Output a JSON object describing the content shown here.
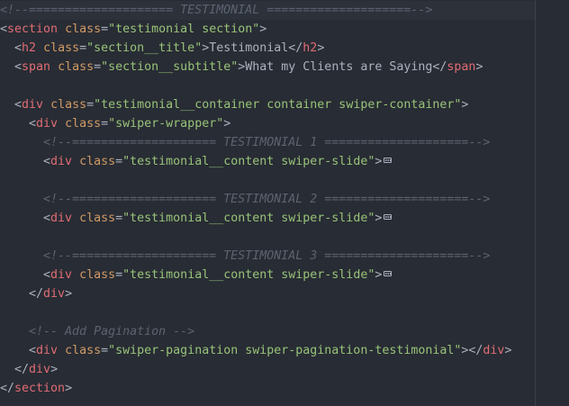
{
  "editor": {
    "language": "html",
    "colors": {
      "background": "#282c34",
      "comment": "#5c6370",
      "tag": "#e06c75",
      "attribute": "#d19a66",
      "string": "#98c379",
      "text": "#abb2bf"
    },
    "lines": [
      [
        [
          "c",
          "<!--==================== TESTIMONIAL ====================-->"
        ]
      ],
      [
        [
          "p",
          "<"
        ],
        [
          "t",
          "section"
        ],
        [
          "p",
          " "
        ],
        [
          "a",
          "class"
        ],
        [
          "p",
          "="
        ],
        [
          "s",
          "\"testimonial section\""
        ],
        [
          "p",
          ">"
        ]
      ],
      [
        [
          "p",
          "  <"
        ],
        [
          "t",
          "h2"
        ],
        [
          "p",
          " "
        ],
        [
          "a",
          "class"
        ],
        [
          "p",
          "="
        ],
        [
          "s",
          "\"section__title\""
        ],
        [
          "p",
          ">"
        ],
        [
          "tx",
          "Testimonial"
        ],
        [
          "p",
          "</"
        ],
        [
          "t",
          "h2"
        ],
        [
          "p",
          ">"
        ]
      ],
      [
        [
          "p",
          "  <"
        ],
        [
          "t",
          "span"
        ],
        [
          "p",
          " "
        ],
        [
          "a",
          "class"
        ],
        [
          "p",
          "="
        ],
        [
          "s",
          "\"section__subtitle\""
        ],
        [
          "p",
          ">"
        ],
        [
          "tx",
          "What my Clients are Saying"
        ],
        [
          "p",
          "</"
        ],
        [
          "t",
          "span"
        ],
        [
          "p",
          ">"
        ]
      ],
      [],
      [
        [
          "p",
          "  <"
        ],
        [
          "t",
          "div"
        ],
        [
          "p",
          " "
        ],
        [
          "a",
          "class"
        ],
        [
          "p",
          "="
        ],
        [
          "s",
          "\"testimonial__container container swiper-container\""
        ],
        [
          "p",
          ">"
        ]
      ],
      [
        [
          "p",
          "    <"
        ],
        [
          "t",
          "div"
        ],
        [
          "p",
          " "
        ],
        [
          "a",
          "class"
        ],
        [
          "p",
          "="
        ],
        [
          "s",
          "\"swiper-wrapper\""
        ],
        [
          "p",
          ">"
        ]
      ],
      [
        [
          "c",
          "      <!--==================== TESTIMONIAL 1 ====================-->"
        ]
      ],
      [
        [
          "p",
          "      <"
        ],
        [
          "t",
          "div"
        ],
        [
          "p",
          " "
        ],
        [
          "a",
          "class"
        ],
        [
          "p",
          "="
        ],
        [
          "s",
          "\"testimonial__content swiper-slide\""
        ],
        [
          "p",
          ">"
        ],
        [
          "fold",
          ""
        ]
      ],
      [],
      [
        [
          "c",
          "      <!--==================== TESTIMONIAL 2 ====================-->"
        ]
      ],
      [
        [
          "p",
          "      <"
        ],
        [
          "t",
          "div"
        ],
        [
          "p",
          " "
        ],
        [
          "a",
          "class"
        ],
        [
          "p",
          "="
        ],
        [
          "s",
          "\"testimonial__content swiper-slide\""
        ],
        [
          "p",
          ">"
        ],
        [
          "fold",
          ""
        ]
      ],
      [],
      [
        [
          "c",
          "      <!--==================== TESTIMONIAL 3 ====================-->"
        ]
      ],
      [
        [
          "p",
          "      <"
        ],
        [
          "t",
          "div"
        ],
        [
          "p",
          " "
        ],
        [
          "a",
          "class"
        ],
        [
          "p",
          "="
        ],
        [
          "s",
          "\"testimonial__content swiper-slide\""
        ],
        [
          "p",
          ">"
        ],
        [
          "fold",
          ""
        ]
      ],
      [
        [
          "p",
          "    </"
        ],
        [
          "t",
          "div"
        ],
        [
          "p",
          ">"
        ]
      ],
      [],
      [
        [
          "c",
          "    <!-- Add Pagination -->"
        ]
      ],
      [
        [
          "p",
          "    <"
        ],
        [
          "t",
          "div"
        ],
        [
          "p",
          " "
        ],
        [
          "a",
          "class"
        ],
        [
          "p",
          "="
        ],
        [
          "s",
          "\"swiper-pagination swiper-pagination-testimonial\""
        ],
        [
          "p",
          "></"
        ],
        [
          "t",
          "div"
        ],
        [
          "p",
          ">"
        ]
      ],
      [
        [
          "p",
          "  </"
        ],
        [
          "t",
          "div"
        ],
        [
          "p",
          ">"
        ]
      ],
      [
        [
          "p",
          "</"
        ],
        [
          "t",
          "section"
        ],
        [
          "p",
          ">"
        ]
      ]
    ]
  }
}
